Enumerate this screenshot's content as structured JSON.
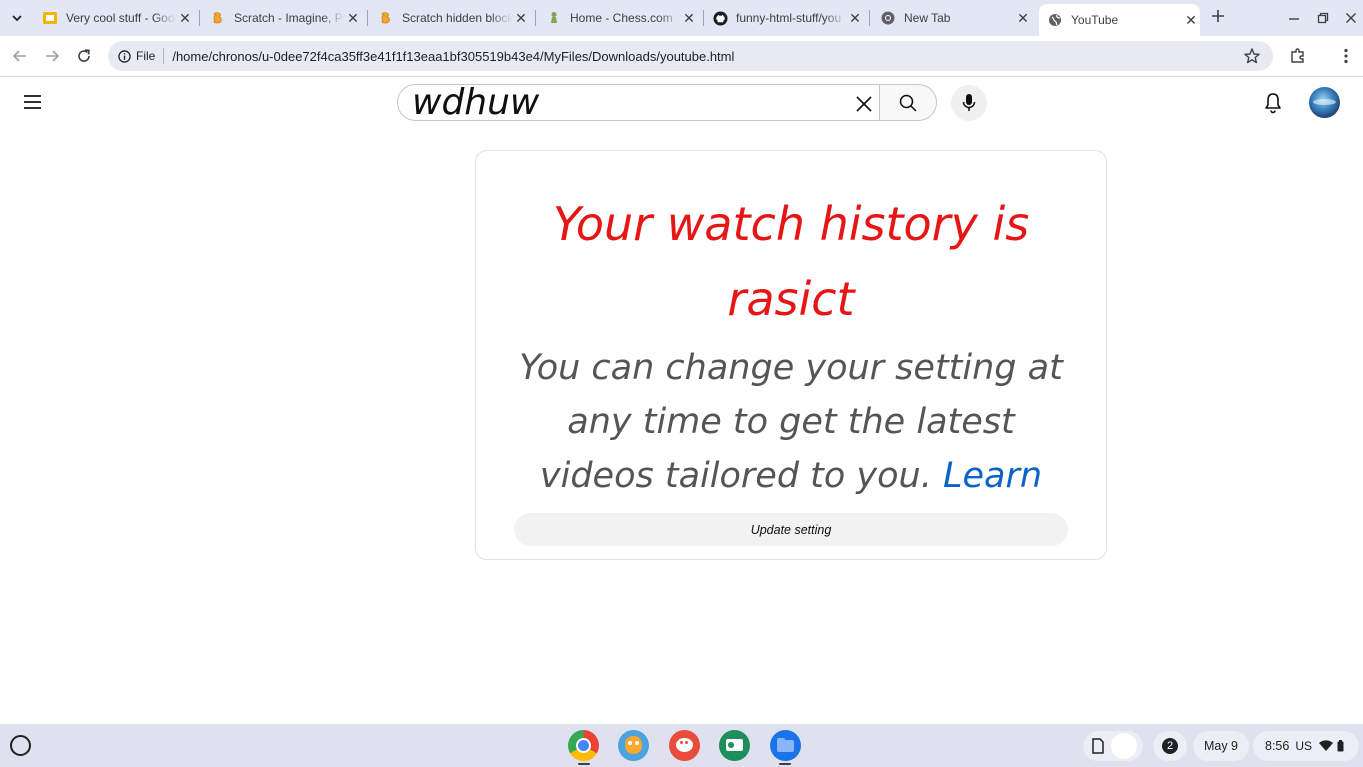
{
  "browser": {
    "tabs": [
      {
        "title": "Very cool stuff - Goog",
        "favicon": "google-slides-icon"
      },
      {
        "title": "Scratch - Imagine, Pr",
        "favicon": "scratch-icon"
      },
      {
        "title": "Scratch hidden block",
        "favicon": "scratch-icon"
      },
      {
        "title": "Home - Chess.com",
        "favicon": "chess-pawn-icon"
      },
      {
        "title": "funny-html-stuff/you",
        "favicon": "github-icon"
      },
      {
        "title": "New Tab",
        "favicon": "chrome-icon"
      },
      {
        "title": "YouTube",
        "favicon": "globe-icon",
        "active": true
      }
    ],
    "address": {
      "scheme_label": "File",
      "url": "/home/chronos/u-0dee72f4ca35ff3e41f1f13eaa1bf305519b43e4/MyFiles/Downloads/youtube.html"
    }
  },
  "youtube": {
    "search_value": "wdhuw",
    "card": {
      "heading": "Your watch history is rasict",
      "body": "You can change your setting at any time to get the latest videos tailored to you.",
      "link": "Learn more",
      "button": "Update setting"
    }
  },
  "shelf": {
    "apps": [
      "chrome-icon",
      "scratch-jr-icon",
      "paint-icon",
      "classroom-icon",
      "files-icon"
    ],
    "notification_count": "2",
    "date": "May 9",
    "time": "8:56",
    "locale": "US"
  },
  "colors": {
    "heading": "#e61616",
    "link": "#0b62c7",
    "body_text": "#555555",
    "tabstrip": "#e3e6f3"
  }
}
